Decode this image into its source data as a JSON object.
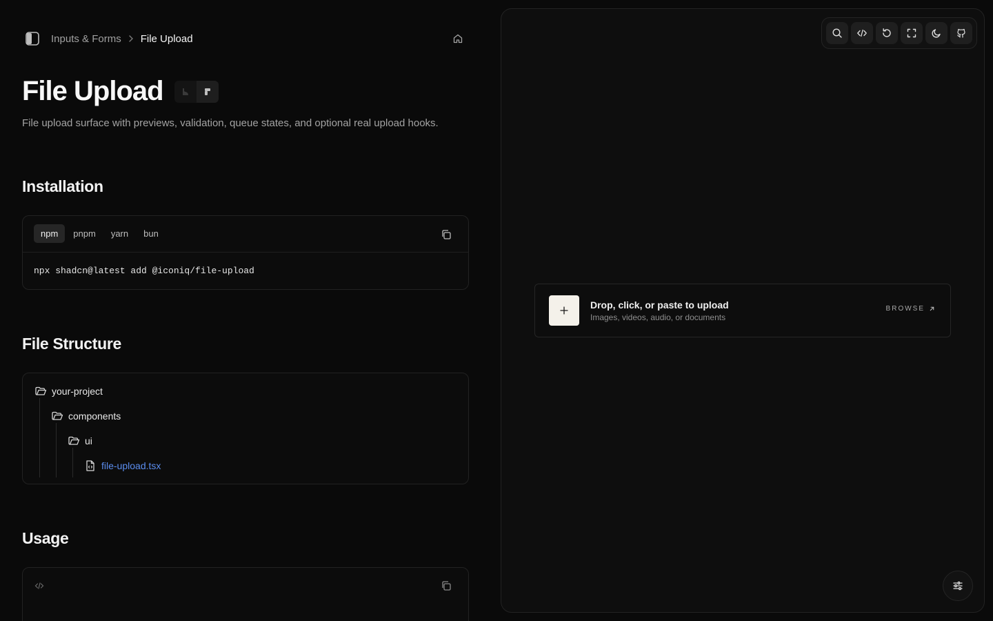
{
  "breadcrumb": {
    "parent": "Inputs & Forms",
    "current": "File Upload"
  },
  "page": {
    "title": "File Upload",
    "description": "File upload surface with previews, validation, queue states, and optional real upload hooks."
  },
  "sections": {
    "installation": "Installation",
    "file_structure": "File Structure",
    "usage": "Usage"
  },
  "install": {
    "tabs": [
      "npm",
      "pnpm",
      "yarn",
      "bun"
    ],
    "active_tab": "npm",
    "command": "npx shadcn@latest add @iconiq/file-upload"
  },
  "tree": {
    "root": "your-project",
    "folder1": "components",
    "folder2": "ui",
    "file": "file-upload.tsx"
  },
  "upload": {
    "title": "Drop, click, or paste to upload",
    "subtitle": "Images, videos, audio, or documents",
    "browse": "BROWSE"
  },
  "icons": {
    "toolbar": [
      "search-icon",
      "code-icon",
      "refresh-icon",
      "fullscreen-icon",
      "moon-icon",
      "github-icon"
    ]
  },
  "colors": {
    "accent_link": "#5b8def",
    "background": "#0a0a0a",
    "panel": "#0e0e0e"
  }
}
